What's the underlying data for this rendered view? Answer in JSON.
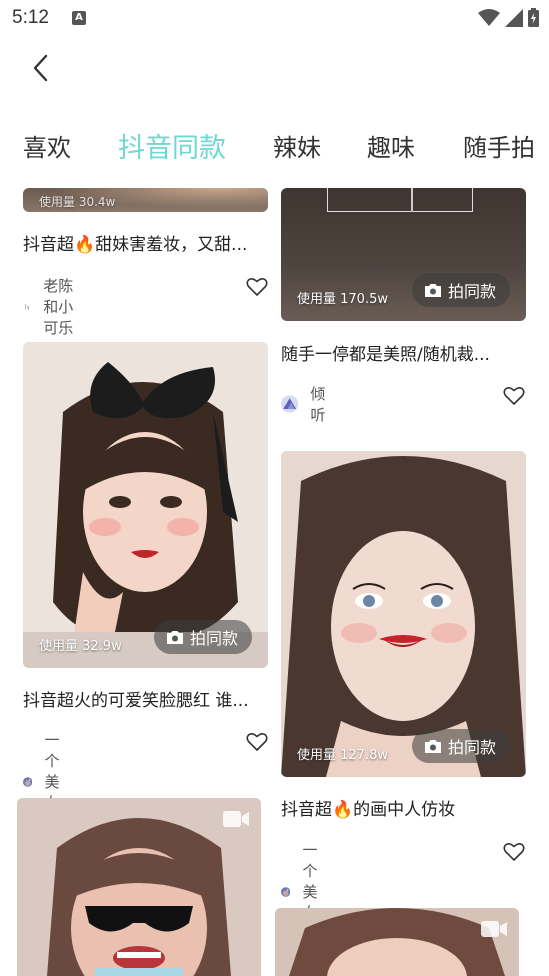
{
  "status": {
    "time": "5:12"
  },
  "tabs": [
    {
      "label": "喜欢",
      "active": false
    },
    {
      "label": "抖音同款",
      "active": true
    },
    {
      "label": "辣妹",
      "active": false
    },
    {
      "label": "趣味",
      "active": false
    },
    {
      "label": "随手拍",
      "active": false
    }
  ],
  "accent_color": "#6fd8d2",
  "cards": [
    {
      "usage": "使用量 30.4w",
      "title": "抖音超🔥甜妹害羞妆，又甜...",
      "author": "老陈和小可乐"
    },
    {
      "usage": "使用量 170.5w",
      "button": "拍同款",
      "title": "随手一停都是美照/随机裁...",
      "author": "倾听"
    },
    {
      "usage": "使用量 32.9w",
      "button": "拍同款",
      "title": "抖音超火的可爱笑脸腮红 谁...",
      "author": "一个美女子"
    },
    {
      "usage": "使用量 127.8w",
      "button": "拍同款",
      "title": "抖音超🔥的画中人仿妆",
      "author": "一个美女子"
    },
    {
      "icon": "video-camera-icon"
    },
    {
      "icon": "video-camera-icon"
    }
  ]
}
